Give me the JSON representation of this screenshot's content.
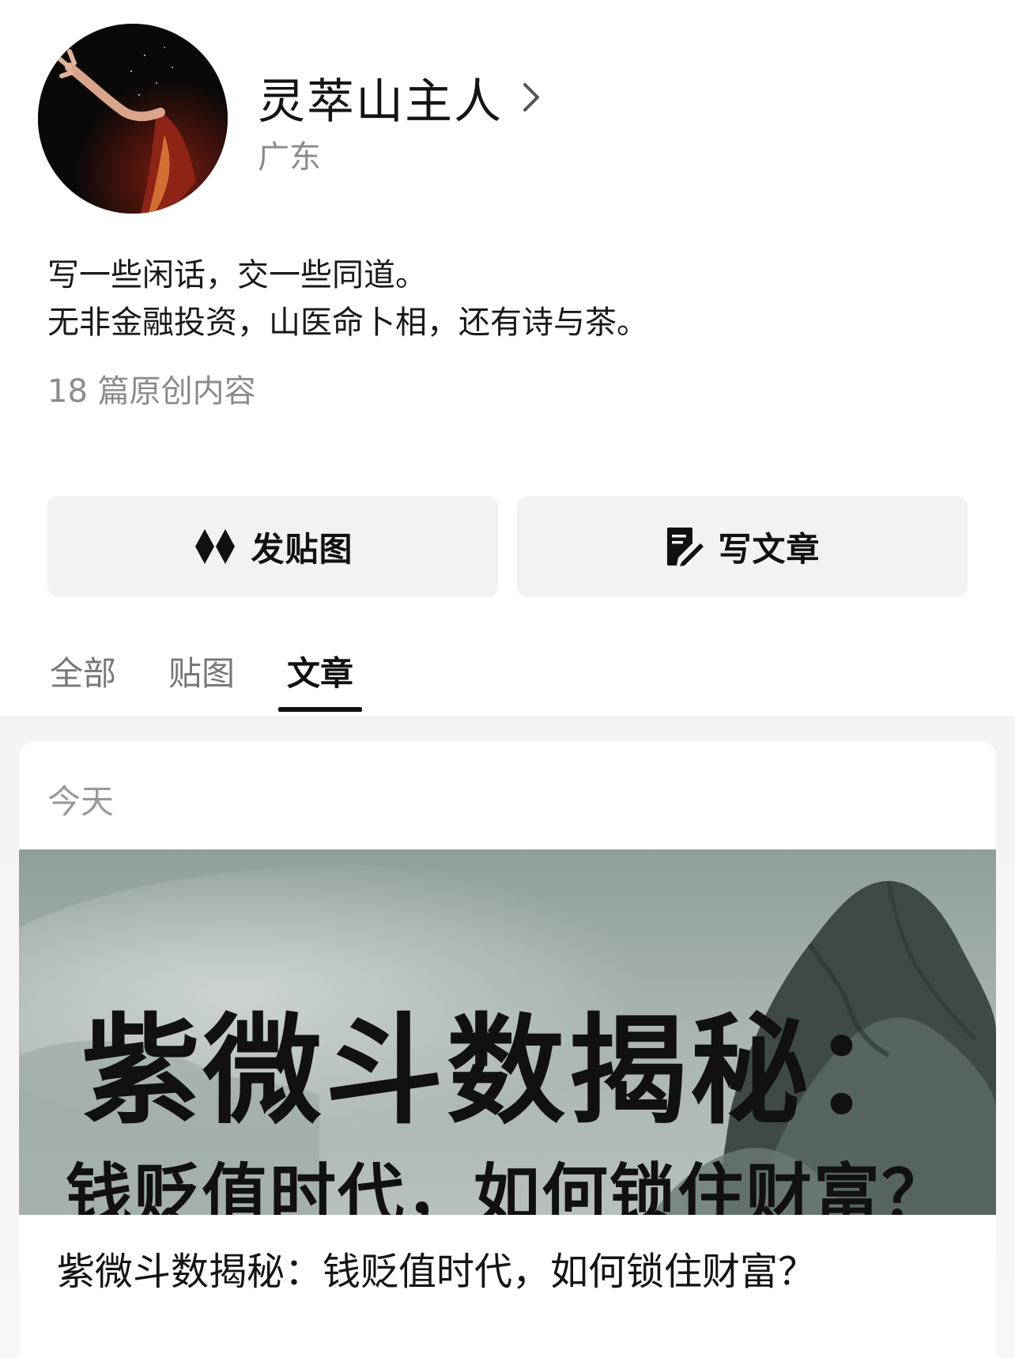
{
  "profile": {
    "name": "灵萃山主人",
    "location": "广东",
    "bio_lines": [
      "写一些闲话，交一些同道。",
      "无非金融投资，山医命卜相，还有诗与茶。"
    ],
    "original_count": "18 篇原创内容"
  },
  "actions": {
    "post_photo_label": "发贴图",
    "post_photo_icon": "diamond-pair-icon",
    "write_article_label": "写文章",
    "write_article_icon": "edit-document-icon"
  },
  "tabs": [
    {
      "label": "全部",
      "active": false
    },
    {
      "label": "贴图",
      "active": false
    },
    {
      "label": "文章",
      "active": true
    }
  ],
  "feed": {
    "date_label": "今天",
    "cover_title": "紫微斗数揭秘：",
    "cover_subtitle": "钱贬值时代，如何锁住财富？",
    "article_title": "紫微斗数揭秘：钱贬值时代，如何锁住财富？"
  }
}
